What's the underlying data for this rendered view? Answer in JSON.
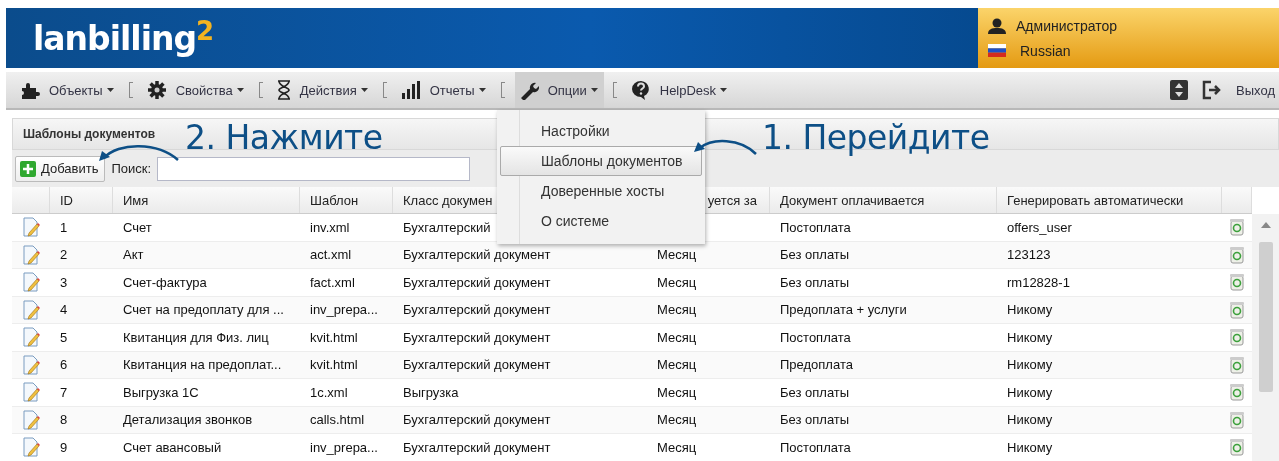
{
  "header": {
    "logo": "lanbilling",
    "logo_superscript": "2",
    "user": "Администратор",
    "language": "Russian"
  },
  "nav": {
    "items": [
      {
        "label": "Объекты",
        "selected": false
      },
      {
        "label": "Свойства",
        "selected": false
      },
      {
        "label": "Действия",
        "selected": false
      },
      {
        "label": "Отчеты",
        "selected": false
      },
      {
        "label": "Опции",
        "selected": true
      },
      {
        "label": "HelpDesk",
        "selected": false
      }
    ],
    "logout": "Выход",
    "menu": [
      {
        "label": "Настройки",
        "selected": false
      },
      {
        "label": "Шаблоны документов",
        "selected": true
      },
      {
        "label": "Доверенные хосты",
        "selected": false
      },
      {
        "label": "О системе",
        "selected": false
      }
    ]
  },
  "panel": {
    "title": "Шаблоны документов",
    "add_button": "Добавить",
    "search_label": "Поиск:"
  },
  "table": {
    "columns": [
      "ID",
      "Имя",
      "Шаблон",
      "Класс докумен",
      "уется за",
      "Документ оплачивается",
      "Генерировать автоматически"
    ],
    "rows": [
      {
        "id": "1",
        "name": "Счет",
        "template": "inv.xml",
        "doc_class": "Бухгалтерский",
        "payment": "Постоплата",
        "auto_generate": "offers_user"
      },
      {
        "id": "2",
        "name": "Акт",
        "template": "act.xml",
        "doc_class": "Бухгалтерский документ",
        "period": "Месяц",
        "payment": "Без оплаты",
        "auto_generate": "123123"
      },
      {
        "id": "3",
        "name": "Счет-фактура",
        "template": "fact.xml",
        "doc_class": "Бухгалтерский документ",
        "period": "Месяц",
        "payment": "Без оплаты",
        "auto_generate": "rm12828-1"
      },
      {
        "id": "4",
        "name": "Счет на предоплату для ...",
        "template": "inv_prepa...",
        "doc_class": "Бухгалтерский документ",
        "period": "Месяц",
        "payment": "Предоплата + услуги",
        "auto_generate": "Никому"
      },
      {
        "id": "5",
        "name": "Квитанция для Физ. лиц",
        "template": "kvit.html",
        "doc_class": "Бухгалтерский документ",
        "period": "Месяц",
        "payment": "Постоплата",
        "auto_generate": "Никому"
      },
      {
        "id": "6",
        "name": "Квитанция на предоплат...",
        "template": "kvit.html",
        "doc_class": "Бухгалтерский документ",
        "period": "Месяц",
        "payment": "Предоплата",
        "auto_generate": "Никому"
      },
      {
        "id": "7",
        "name": "Выгрузка 1С",
        "template": "1c.xml",
        "doc_class": "Выгрузка",
        "period": "Месяц",
        "payment": "Без оплаты",
        "auto_generate": "Никому"
      },
      {
        "id": "8",
        "name": "Детализация звонков",
        "template": "calls.html",
        "doc_class": "Бухгалтерский документ",
        "period": "Месяц",
        "payment": "Без оплаты",
        "auto_generate": "Никому"
      },
      {
        "id": "9",
        "name": "Счет авансовый",
        "template": "inv_prepa...",
        "doc_class": "Бухгалтерский документ",
        "period": "Месяц",
        "payment": "Постоплата",
        "auto_generate": "Никому"
      }
    ]
  },
  "annotations": [
    {
      "kind": "step",
      "text": "2. Нажмите"
    },
    {
      "kind": "step",
      "text": "1. Перейдите"
    }
  ]
}
